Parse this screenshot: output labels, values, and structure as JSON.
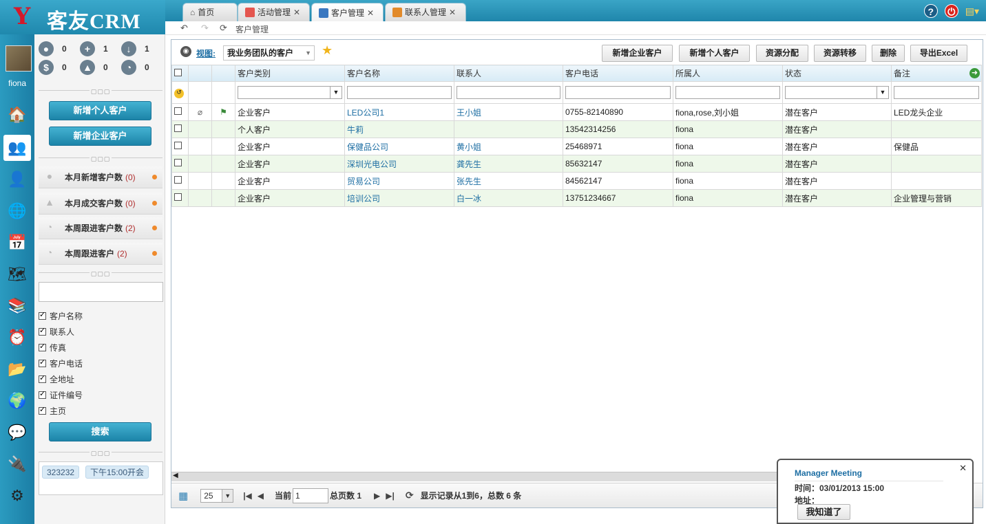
{
  "app": {
    "brand": "客友CRM",
    "logo_mark": "Y"
  },
  "tabs": [
    {
      "label": "首页",
      "closable": false
    },
    {
      "label": "活动管理",
      "closable": true
    },
    {
      "label": "客户管理",
      "closable": true,
      "active": true
    },
    {
      "label": "联系人管理",
      "closable": true
    }
  ],
  "breadcrumb": "客户管理",
  "user": {
    "name": "fiona"
  },
  "stats": {
    "s1": "0",
    "s2": "1",
    "s3": "1",
    "s4": "0",
    "s5": "0",
    "s6": "0"
  },
  "left_buttons": {
    "add_person": "新增个人客户",
    "add_company": "新增企业客户",
    "search": "搜索"
  },
  "counts": [
    {
      "label": "本月新增客户数",
      "n": "(0)"
    },
    {
      "label": "本月成交客户数",
      "n": "(0)"
    },
    {
      "label": "本周跟进客户数",
      "n": "(2)"
    },
    {
      "label": "本周跟进客户",
      "n": "(2)"
    }
  ],
  "search_fields": [
    "客户名称",
    "联系人",
    "传真",
    "客户电话",
    "全地址",
    "证件编号",
    "主页"
  ],
  "tags": [
    "323232",
    "下午15:00开会"
  ],
  "view": {
    "label": "视图:",
    "selected": "我业务团队的客户"
  },
  "actions": [
    "新增企业客户",
    "新增个人客户",
    "资源分配",
    "资源转移",
    "删除",
    "导出Excel"
  ],
  "columns": [
    "客户类别",
    "客户名称",
    "联系人",
    "客户电话",
    "所属人",
    "状态",
    "备注"
  ],
  "rows": [
    {
      "type": "企业客户",
      "name": "LED公司1",
      "contact": "王小姐",
      "phone": "0755-82140890",
      "owner": "fiona,rose,刘小姐",
      "status": "潜在客户",
      "note": "LED龙头企业"
    },
    {
      "type": "个人客户",
      "name": "牛莉",
      "contact": "",
      "phone": "13542314256",
      "owner": "fiona",
      "status": "潜在客户",
      "note": ""
    },
    {
      "type": "企业客户",
      "name": "保健品公司",
      "contact": "黄小姐",
      "phone": "25468971",
      "owner": "fiona",
      "status": "潜在客户",
      "note": "保健品"
    },
    {
      "type": "企业客户",
      "name": "深圳光电公司",
      "contact": "龚先生",
      "phone": "85632147",
      "owner": "fiona",
      "status": "潜在客户",
      "note": ""
    },
    {
      "type": "企业客户",
      "name": "贸易公司",
      "contact": "张先生",
      "phone": "84562147",
      "owner": "fiona",
      "status": "潜在客户",
      "note": ""
    },
    {
      "type": "企业客户",
      "name": "培训公司",
      "contact": "白一冰",
      "phone": "13751234667",
      "owner": "fiona",
      "status": "潜在客户",
      "note": "企业管理与营销"
    }
  ],
  "pager": {
    "page_size": "25",
    "current_label": "当前",
    "current": "1",
    "total_label": "总页数 1",
    "info": "显示记录从1到6，总数 6 条"
  },
  "popup": {
    "title": "Manager Meeting",
    "time": "时间：03/01/2013 15:00",
    "addr": "地址：",
    "button": "我知道了"
  }
}
